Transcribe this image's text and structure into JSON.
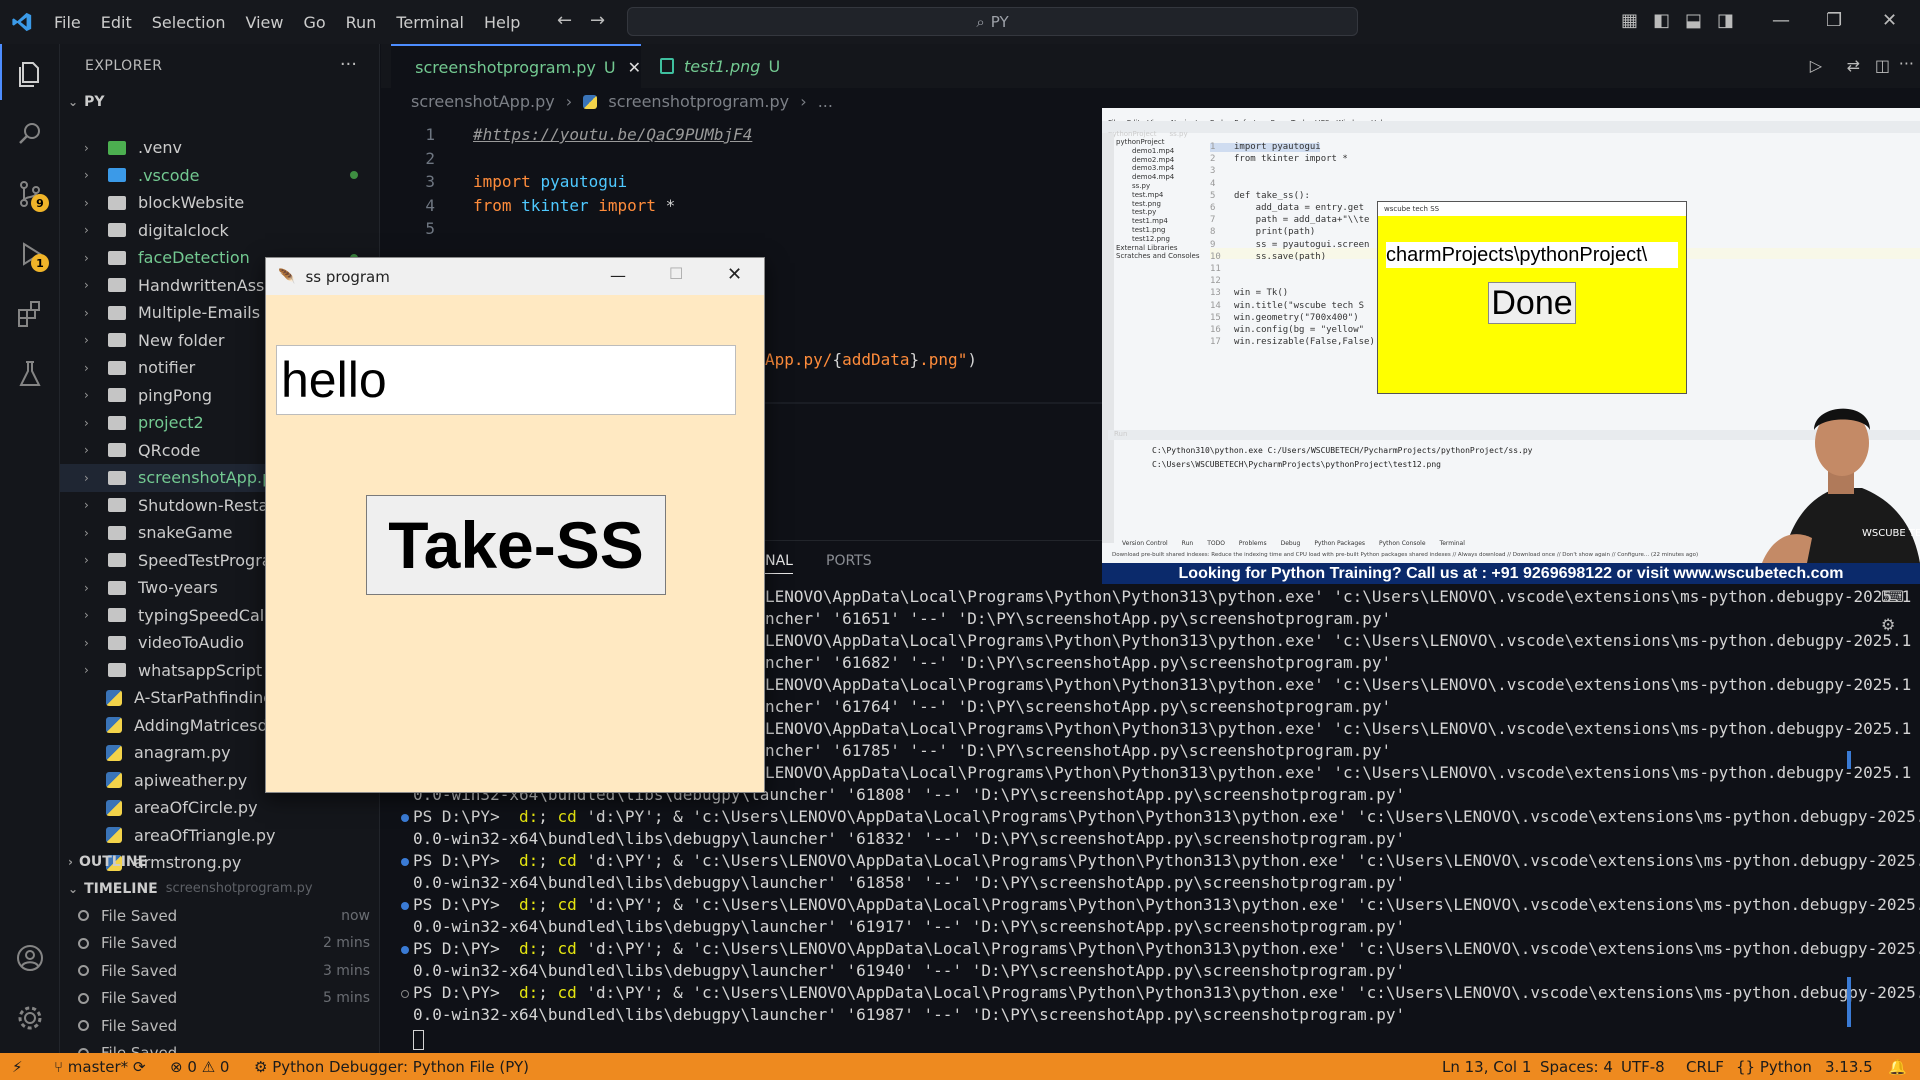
{
  "titlebar": {
    "menu": [
      "File",
      "Edit",
      "Selection",
      "View",
      "Go",
      "Run",
      "Terminal",
      "Help"
    ],
    "search": "PY"
  },
  "activity": {
    "scm_badge": "9",
    "debug_badge": "1"
  },
  "sidebar": {
    "header": "EXPLORER",
    "root": "PY",
    "items": [
      {
        "label": ".venv",
        "type": "folder-venv"
      },
      {
        "label": ".vscode",
        "type": "folder-vscode"
      },
      {
        "label": "blockWebsite",
        "type": "folder"
      },
      {
        "label": "digitalclock",
        "type": "folder"
      },
      {
        "label": "faceDetection",
        "type": "folder"
      },
      {
        "label": "HandwrittenAssign",
        "type": "folder"
      },
      {
        "label": "Multiple-Emails",
        "type": "folder"
      },
      {
        "label": "New folder",
        "type": "folder"
      },
      {
        "label": "notifier",
        "type": "folder"
      },
      {
        "label": "pingPong",
        "type": "folder"
      },
      {
        "label": "project2",
        "type": "folder"
      },
      {
        "label": "QRcode",
        "type": "folder"
      },
      {
        "label": "screenshotApp.py",
        "type": "folder"
      },
      {
        "label": "Shutdown-Restart",
        "type": "folder"
      },
      {
        "label": "snakeGame",
        "type": "folder"
      },
      {
        "label": "SpeedTestProgram",
        "type": "folder"
      },
      {
        "label": "Two-years",
        "type": "folder"
      },
      {
        "label": "typingSpeedCalcul",
        "type": "folder"
      },
      {
        "label": "videoToAudio",
        "type": "folder"
      },
      {
        "label": "whatsappScript",
        "type": "folder"
      },
      {
        "label": "A-StarPathfinding.p",
        "type": "py"
      },
      {
        "label": "AddingMatricesdia",
        "type": "py"
      },
      {
        "label": "anagram.py",
        "type": "py"
      },
      {
        "label": "apiweather.py",
        "type": "py"
      },
      {
        "label": "areaOfCircle.py",
        "type": "py"
      },
      {
        "label": "areaOfTriangle.py",
        "type": "py"
      },
      {
        "label": "armstrong.py",
        "type": "py"
      }
    ],
    "outline": "OUTLINE",
    "timeline": "TIMELINE",
    "timeline_file": "screenshotprogram.py",
    "timeline_items": [
      {
        "label": "File Saved",
        "when": "now"
      },
      {
        "label": "File Saved",
        "when": "2 mins"
      },
      {
        "label": "File Saved",
        "when": "3 mins"
      },
      {
        "label": "File Saved",
        "when": "5 mins"
      },
      {
        "label": "File Saved",
        "when": ""
      },
      {
        "label": "File Saved",
        "when": ""
      }
    ]
  },
  "editor": {
    "tabs": [
      {
        "label": "screenshotprogram.py",
        "status": "U"
      },
      {
        "label": "test1.png",
        "status": "U"
      }
    ],
    "breadcrumb": [
      "screenshotApp.py",
      "screenshotprogram.py",
      "..."
    ],
    "lines": [
      {
        "n": "1",
        "text": "#https://youtu.be/QaC9PUMbjF4"
      },
      {
        "n": "2",
        "text": ""
      },
      {
        "n": "3",
        "text": "import pyautogui"
      },
      {
        "n": "4",
        "text": "from tkinter import *"
      },
      {
        "n": "5",
        "text": ""
      }
    ],
    "fragment_line": "App.py/{addData}.png\")"
  },
  "panel": {
    "tabs": [
      "INAL",
      "PORTS"
    ],
    "partial_lines": [
      "LENOVO\\AppData\\Local\\Programs\\Python\\Python313\\python.exe' 'c:\\Users\\LENOVO\\.vscode\\extensions\\ms-python.debugpy-2025.1",
      "ncher' '61651' '--' 'D:\\PY\\screenshotApp.py\\screenshotprogram.py'",
      "LENOVO\\AppData\\Local\\Programs\\Python\\Python313\\python.exe' 'c:\\Users\\LENOVO\\.vscode\\extensions\\ms-python.debugpy-2025.1",
      "ncher' '61682' '--' 'D:\\PY\\screenshotApp.py\\screenshotprogram.py'",
      "LENOVO\\AppData\\Local\\Programs\\Python\\Python313\\python.exe' 'c:\\Users\\LENOVO\\.vscode\\extensions\\ms-python.debugpy-2025.1",
      "ncher' '61764' '--' 'D:\\PY\\screenshotApp.py\\screenshotprogram.py'",
      "LENOVO\\AppData\\Local\\Programs\\Python\\Python313\\python.exe' 'c:\\Users\\LENOVO\\.vscode\\extensions\\ms-python.debugpy-2025.1",
      "ncher' '61785' '--' 'D:\\PY\\screenshotApp.py\\screenshotprogram.py'",
      "LENOVO\\AppData\\Local\\Programs\\Python\\Python313\\python.exe' 'c:\\Users\\LENOVO\\.vscode\\extensions\\ms-python.debugpy-2025.1"
    ],
    "partial_last": "0.0-win32-x64\\bundled\\libs\\debugpy\\launcher' '61808' '--' 'D:\\PY\\screenshotApp.py\\screenshotprogram.py'",
    "full_lines": [
      {
        "a": "PS D:\\PY>  d:; cd 'd:\\PY'; & 'c:\\Users\\LENOVO\\AppData\\Local\\Programs\\Python\\Python313\\python.exe' 'c:\\Users\\LENOVO\\.vscode\\extensions\\ms-python.debugpy-2025.1",
        "b": "0.0-win32-x64\\bundled\\libs\\debugpy\\launcher' '61832' '--' 'D:\\PY\\screenshotApp.py\\screenshotprogram.py'"
      },
      {
        "a": "PS D:\\PY>  d:; cd 'd:\\PY'; & 'c:\\Users\\LENOVO\\AppData\\Local\\Programs\\Python\\Python313\\python.exe' 'c:\\Users\\LENOVO\\.vscode\\extensions\\ms-python.debugpy-2025.1",
        "b": "0.0-win32-x64\\bundled\\libs\\debugpy\\launcher' '61858' '--' 'D:\\PY\\screenshotApp.py\\screenshotprogram.py'"
      },
      {
        "a": "PS D:\\PY>  d:; cd 'd:\\PY'; & 'c:\\Users\\LENOVO\\AppData\\Local\\Programs\\Python\\Python313\\python.exe' 'c:\\Users\\LENOVO\\.vscode\\extensions\\ms-python.debugpy-2025.1",
        "b": "0.0-win32-x64\\bundled\\libs\\debugpy\\launcher' '61917' '--' 'D:\\PY\\screenshotApp.py\\screenshotprogram.py'"
      },
      {
        "a": "PS D:\\PY>  d:; cd 'd:\\PY'; & 'c:\\Users\\LENOVO\\AppData\\Local\\Programs\\Python\\Python313\\python.exe' 'c:\\Users\\LENOVO\\.vscode\\extensions\\ms-python.debugpy-2025.1",
        "b": "0.0-win32-x64\\bundled\\libs\\debugpy\\launcher' '61940' '--' 'D:\\PY\\screenshotApp.py\\screenshotprogram.py'"
      },
      {
        "a": "PS D:\\PY>  d:; cd 'd:\\PY'; & 'c:\\Users\\LENOVO\\AppData\\Local\\Programs\\Python\\Python313\\python.exe' 'c:\\Users\\LENOVO\\.vscode\\extensions\\ms-python.debugpy-2025.1",
        "b": "0.0-win32-x64\\bundled\\libs\\debugpy\\launcher' '61987' '--' 'D:\\PY\\screenshotApp.py\\screenshotprogram.py'"
      }
    ]
  },
  "tk": {
    "title": "ss program",
    "entry_value": "hello",
    "button_label": "Take-SS"
  },
  "video": {
    "menu": [
      "File",
      "Edit",
      "View",
      "Navigate",
      "Code",
      "Refactor",
      "Run",
      "Tools",
      "VCS",
      "Window",
      "Help"
    ],
    "project": "pythonProject",
    "file_tab": "ss.py",
    "tree": [
      "pythonProject",
      "demo1.mp4",
      "demo2.mp4",
      "demo3.mp4",
      "demo4.mp4",
      "ss.py",
      "test.mp4",
      "test.png",
      "test.py",
      "test1.mp4",
      "test1.png",
      "test12.png",
      "External Libraries",
      "Scratches and Consoles"
    ],
    "code": [
      "import pyautogui",
      "from tkinter import *",
      "",
      "",
      "def take_ss():",
      "    add_data = entry.get",
      "    path = add_data+\"\\\\te",
      "    print(path)",
      "    ss = pyautogui.screen",
      "    ss.save(path)",
      "",
      "",
      "win = Tk()",
      "win.title(\"wscube tech S",
      "win.geometry(\"700x400\")",
      "win.config(bg = \"yellow\"",
      "win.resizable(False,False)"
    ],
    "yellow_title": "wscube tech SS",
    "yellow_entry": "charmProjects\\pythonProject\\",
    "yellow_button": "Done",
    "run_label": "Run",
    "run_lines": [
      "C:\\Python310\\python.exe C:/Users/WSCUBETECH/PycharmProjects/pythonProject/ss.py",
      "C:\\Users\\WSCUBETECH\\PycharmProjects\\pythonProject\\test12.png"
    ],
    "bottom_tabs": [
      "Version Control",
      "Run",
      "TODO",
      "Problems",
      "Debug",
      "Python Packages",
      "Python Console",
      "Terminal"
    ],
    "notice": "Download pre-built shared indexes: Reduce the indexing time and CPU load with pre-built Python packages shared indexes // Always download // Download once // Don't show again // Configure... (22 minutes ago)",
    "shirt_text": "WSCUBE TECH",
    "banner": "Looking for Python Training? Call us at : +91 9269698122 or visit www.wscubetech.com"
  },
  "status": {
    "branch": "master*",
    "errors": "0",
    "warnings": "0",
    "debugger": "Python Debugger: Python File (PY)",
    "position": "Ln 13, Col 1",
    "spaces": "Spaces: 4",
    "encoding": "UTF-8",
    "eol": "CRLF",
    "language": "Python",
    "version": "3.13.5"
  },
  "colors": {
    "statusbar": "#ee8a1f",
    "tk_bg": "#ffe9c2",
    "yellow_win": "#ffff00",
    "banner": "#0b2a6b"
  }
}
